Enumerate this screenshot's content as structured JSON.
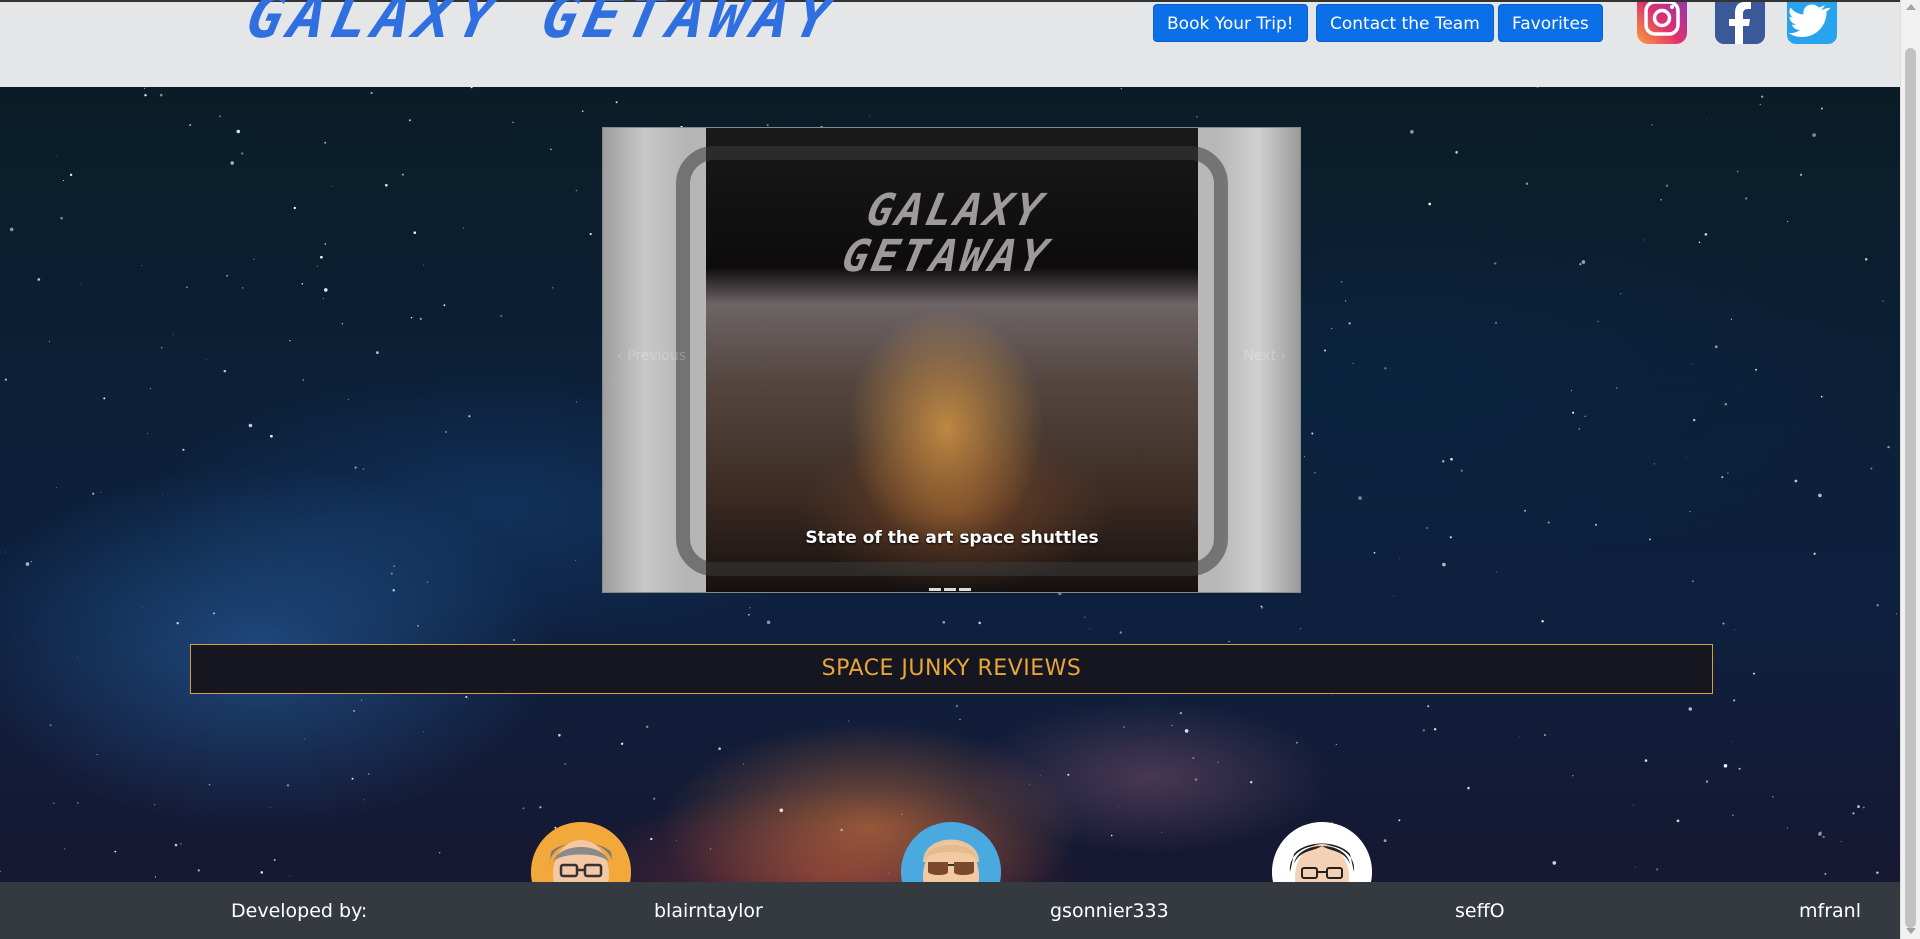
{
  "header": {
    "logo": "GALAXY GETAWAY",
    "nav": [
      {
        "label": "Book Your Trip!"
      },
      {
        "label": "Contact the Team"
      },
      {
        "label": "Favorites"
      }
    ],
    "social": [
      "instagram-icon",
      "facebook-icon",
      "twitter-icon"
    ]
  },
  "carousel": {
    "slide_logo": "GALAXY GETAWAY",
    "caption": "State of the art space shuttles",
    "prev_label": "Previous",
    "next_label": "Next",
    "indicator_count": 3
  },
  "reviews": {
    "title": "SPACE JUNKY REVIEWS"
  },
  "footer": {
    "developed_by": "Developed by:",
    "developers": [
      "blairntaylor",
      "gsonnier333",
      "seffO",
      "mfranl"
    ]
  },
  "colors": {
    "nav_button": "#0b6fe8",
    "logo": "#2f6fe0",
    "reviews_accent": "#e8a53a",
    "footer_bg": "#343a40"
  }
}
